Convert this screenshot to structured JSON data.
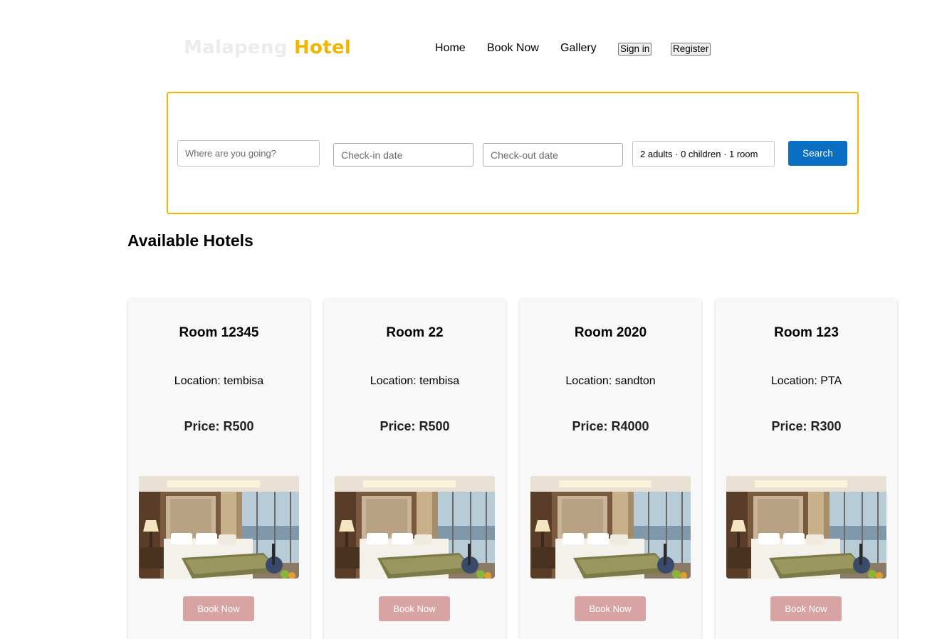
{
  "header": {
    "brand_part1": "Malapeng",
    "brand_part2": "Hotel",
    "nav": {
      "home": "Home",
      "book_now": "Book Now",
      "gallery": "Gallery",
      "sign_in": "Sign in",
      "register": "Register"
    }
  },
  "search": {
    "destination_placeholder": "Where are you going?",
    "checkin_placeholder": "Check-in date",
    "checkout_placeholder": "Check-out date",
    "guests_value": "2 adults · 0 children · 1 room",
    "search_label": "Search"
  },
  "main": {
    "title": "Available Hotels",
    "rooms": [
      {
        "title": "Room 12345",
        "location": "Location: tembisa",
        "price": "Price: R500",
        "book_label": "Book Now"
      },
      {
        "title": "Room 22",
        "location": "Location: tembisa",
        "price": "Price: R500",
        "book_label": "Book Now"
      },
      {
        "title": "Room 2020",
        "location": "Location: sandton",
        "price": "Price: R4000",
        "book_label": "Book Now"
      },
      {
        "title": "Room 123",
        "location": "Location: PTA",
        "price": "Price: R300",
        "book_label": "Book Now"
      }
    ]
  },
  "colors": {
    "brand_accent": "#f2b600",
    "search_button": "#0a6fc2",
    "book_button": "#d8a3a3"
  }
}
